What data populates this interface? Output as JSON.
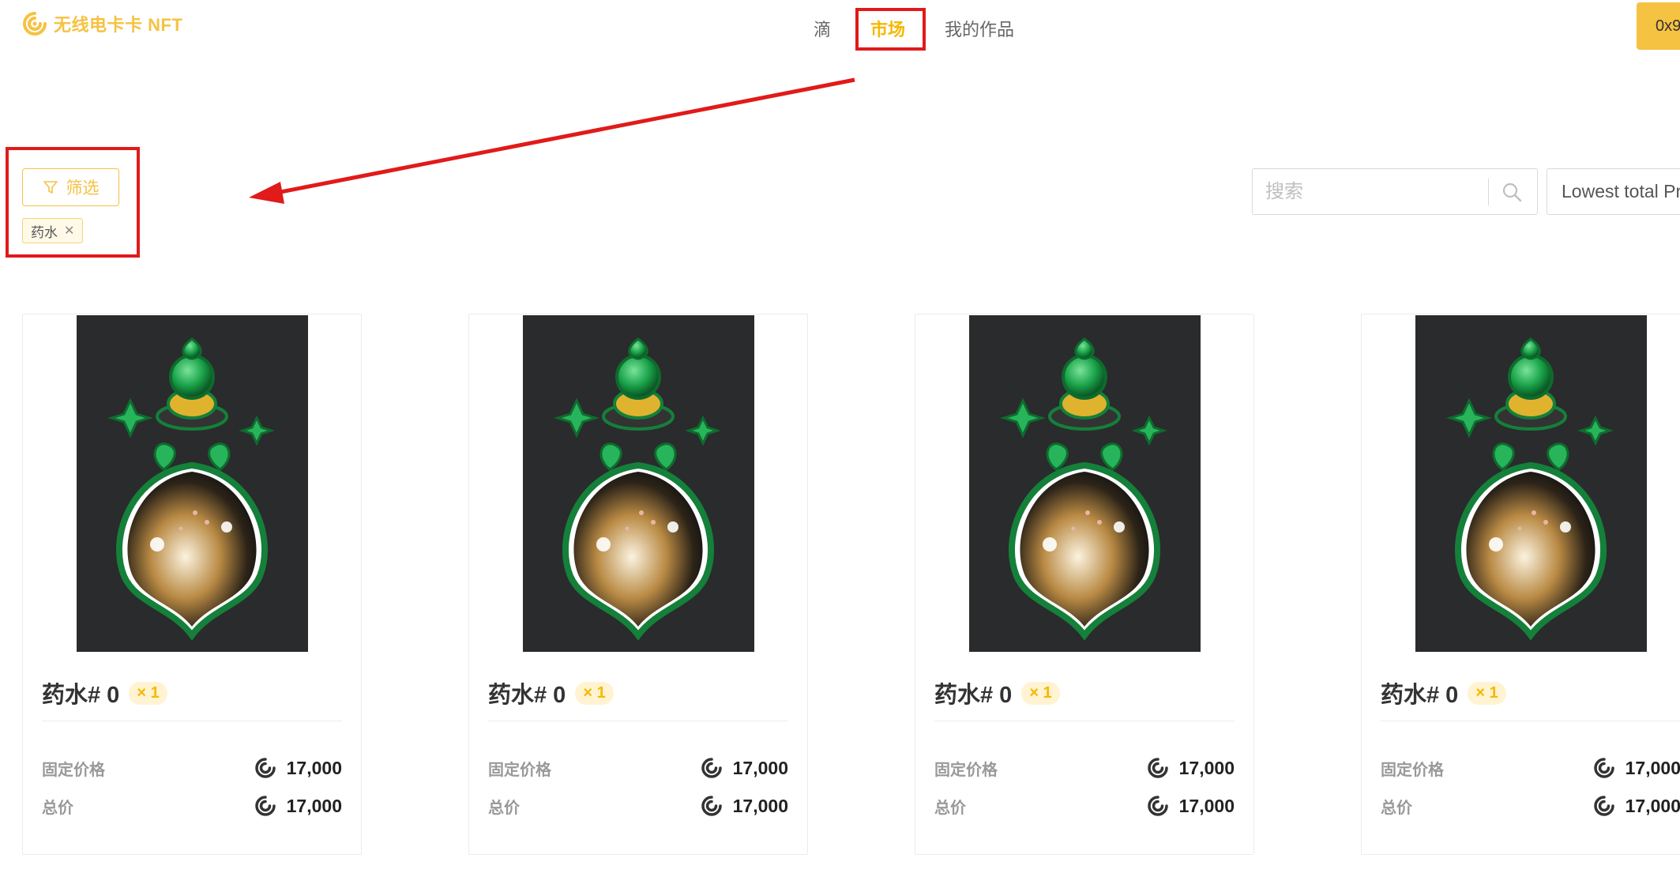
{
  "header": {
    "logo_text": "无线电卡卡 NFT",
    "nav": [
      {
        "label": "滴",
        "active": false
      },
      {
        "label": "市场",
        "active": true
      },
      {
        "label": "我的作品",
        "active": false
      }
    ],
    "wallet_label": "0x9"
  },
  "filter": {
    "button_label": "筛选",
    "active_tag": "药水"
  },
  "search": {
    "placeholder": "搜索"
  },
  "sort": {
    "selected": "Lowest total Pr"
  },
  "cards": [
    {
      "title": "药水# 0",
      "qty": "× 1",
      "fixed_label": "固定价格",
      "fixed_price": "17,000",
      "total_label": "总价",
      "total_price": "17,000"
    },
    {
      "title": "药水# 0",
      "qty": "× 1",
      "fixed_label": "固定价格",
      "fixed_price": "17,000",
      "total_label": "总价",
      "total_price": "17,000"
    },
    {
      "title": "药水# 0",
      "qty": "× 1",
      "fixed_label": "固定价格",
      "fixed_price": "17,000",
      "total_label": "总价",
      "total_price": "17,000"
    },
    {
      "title": "药水# 0",
      "qty": "× 1",
      "fixed_label": "固定价格",
      "fixed_price": "17,000",
      "total_label": "总价",
      "total_price": "17,000"
    }
  ],
  "colors": {
    "accent": "#f5c242",
    "annotation": "#e11a1a",
    "card_image_bg": "#2a2b2c"
  },
  "icons": [
    "logo-swirl-icon",
    "filter-funnel-icon",
    "close-icon",
    "search-icon",
    "currency-swirl-icon",
    "potion-artwork"
  ]
}
